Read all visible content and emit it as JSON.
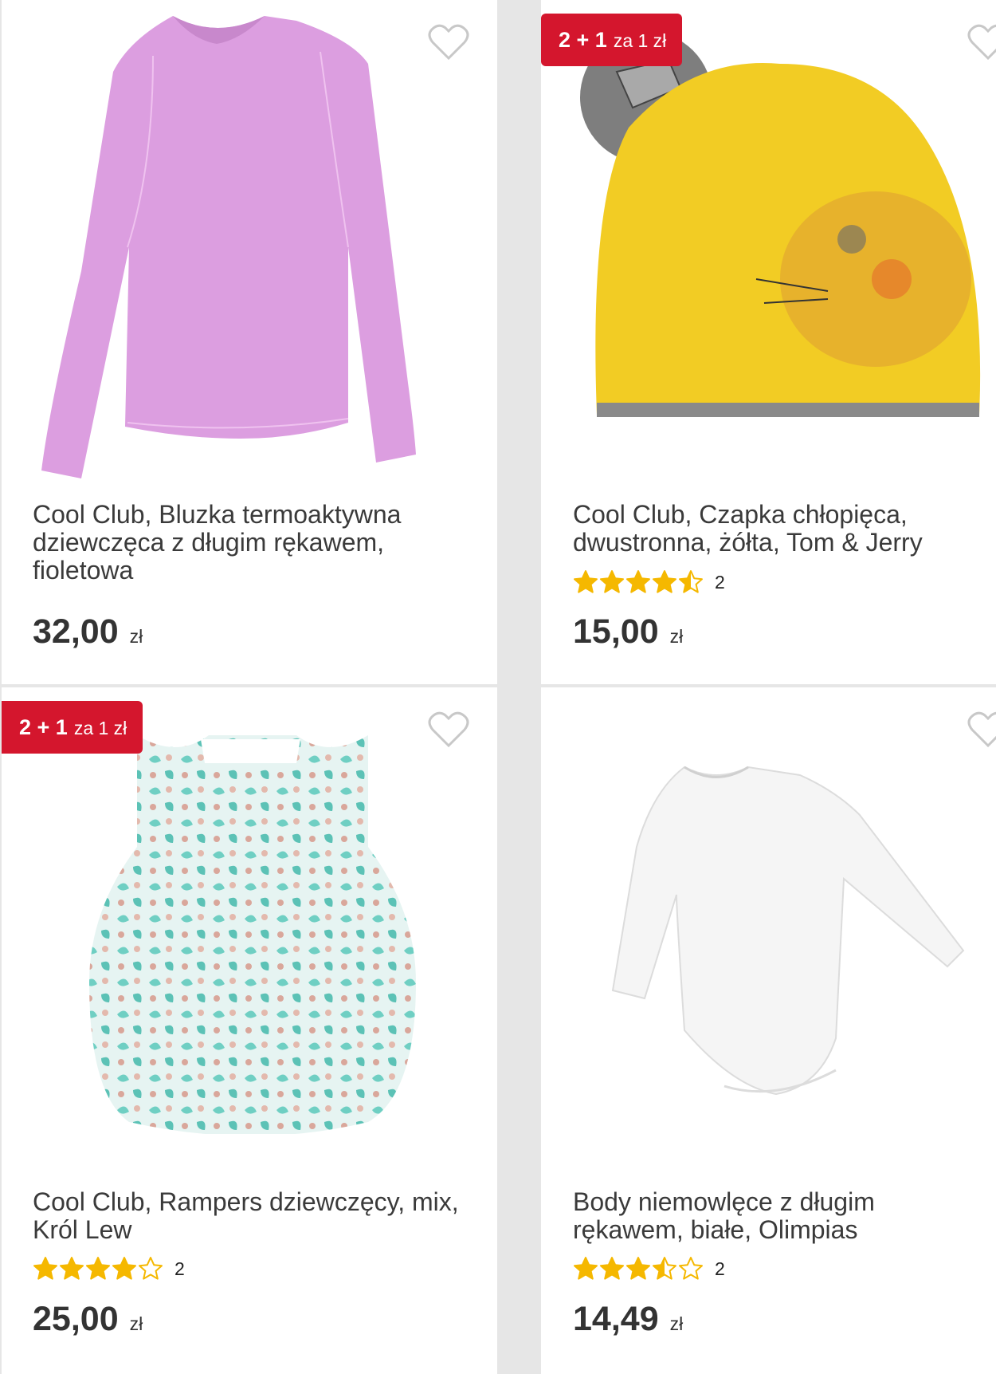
{
  "products": [
    {
      "title": "Cool Club, Bluzka termoaktywna dziewczęca z długim rękawem, fioletowa",
      "price": "32,00",
      "currency": "zł",
      "badge": null,
      "rating": null,
      "image": "pink-longsleeve-shirt"
    },
    {
      "title": "Cool Club, Czapka chłopięca, dwustronna, żółta, Tom & Jerry",
      "price": "15,00",
      "currency": "zł",
      "badge": {
        "main": "2 + 1",
        "rest": "za 1 zł"
      },
      "rating": {
        "stars": 4.5,
        "count": "2"
      },
      "image": "yellow-beanie-tom-jerry"
    },
    {
      "title": "Cool Club, Rampers dziewczęcy, mix, Król Lew",
      "price": "25,00",
      "currency": "zł",
      "badge": {
        "main": "2 + 1",
        "rest": "za 1 zł"
      },
      "rating": {
        "stars": 4,
        "count": "2"
      },
      "image": "floral-romper"
    },
    {
      "title": "Body niemowlęce z długim rękawem, białe, Olimpias",
      "price": "14,49",
      "currency": "zł",
      "badge": null,
      "rating": {
        "stars": 3.5,
        "count": "2"
      },
      "image": "white-baby-bodysuit"
    }
  ],
  "colors": {
    "badge": "#d4162d",
    "star": "#f5b800",
    "text": "#3a3a3a",
    "heart": "#c8c8c8"
  },
  "icons": {
    "favorite": "heart-icon",
    "star": "star-icon"
  }
}
